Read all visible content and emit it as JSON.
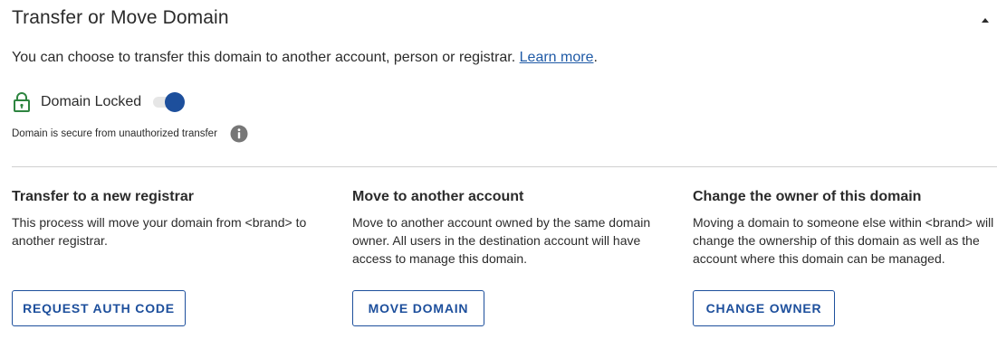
{
  "header": {
    "title": "Transfer or Move Domain",
    "collapse_icon": "caret-up-icon"
  },
  "intro": {
    "text": "You can choose to transfer this domain to another account, person or registrar.",
    "link_label": "Learn more",
    "trailing": "."
  },
  "lock": {
    "icon": "lock-icon",
    "label": "Domain Locked",
    "enabled": true,
    "secure_text": "Domain is secure from unauthorized transfer",
    "info_icon": "info-icon"
  },
  "options": [
    {
      "title": "Transfer to a new registrar",
      "description": "This process will move your domain from <brand> to another registrar.",
      "button_label": "REQUEST AUTH CODE"
    },
    {
      "title": "Move to another account",
      "description": "Move to another account owned by the same domain owner. All users in the destination account will have access to manage this domain.",
      "button_label": "MOVE DOMAIN"
    },
    {
      "title": "Change the owner of this domain",
      "description": "Moving a domain to someone else within <brand> will change the ownership of this domain as well as the account where this domain can be managed.",
      "button_label": "CHANGE OWNER"
    }
  ],
  "colors": {
    "accent": "#1d4f9c",
    "lock_green": "#2e8540",
    "info_gray": "#777777",
    "divider": "#d0d0d0"
  }
}
